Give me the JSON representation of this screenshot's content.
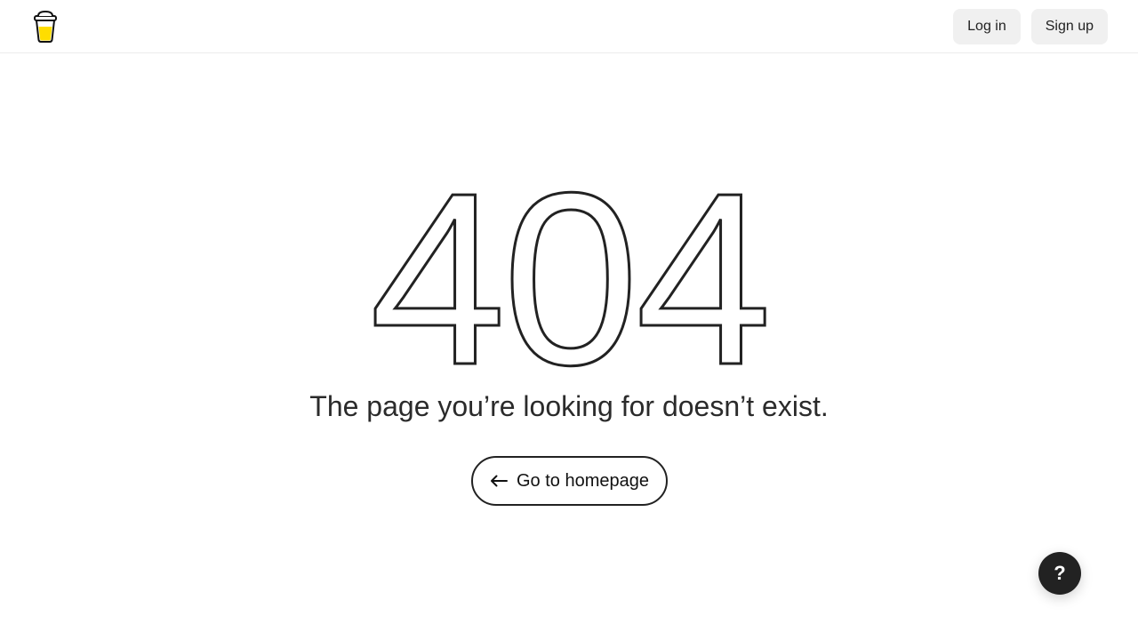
{
  "header": {
    "logo_icon": "coffee-cup-icon",
    "login_label": "Log in",
    "signup_label": "Sign up"
  },
  "error": {
    "code": "404",
    "message": "The page you’re looking for doesn’t exist."
  },
  "home_button": {
    "icon": "arrow-left-icon",
    "label": "Go to homepage"
  },
  "help_button": {
    "icon": "question-mark-icon",
    "label": "?"
  },
  "colors": {
    "text": "#222222",
    "button_bg": "#f0f0f0",
    "cup_yellow": "#FFDD00",
    "help_bg": "#222222"
  }
}
